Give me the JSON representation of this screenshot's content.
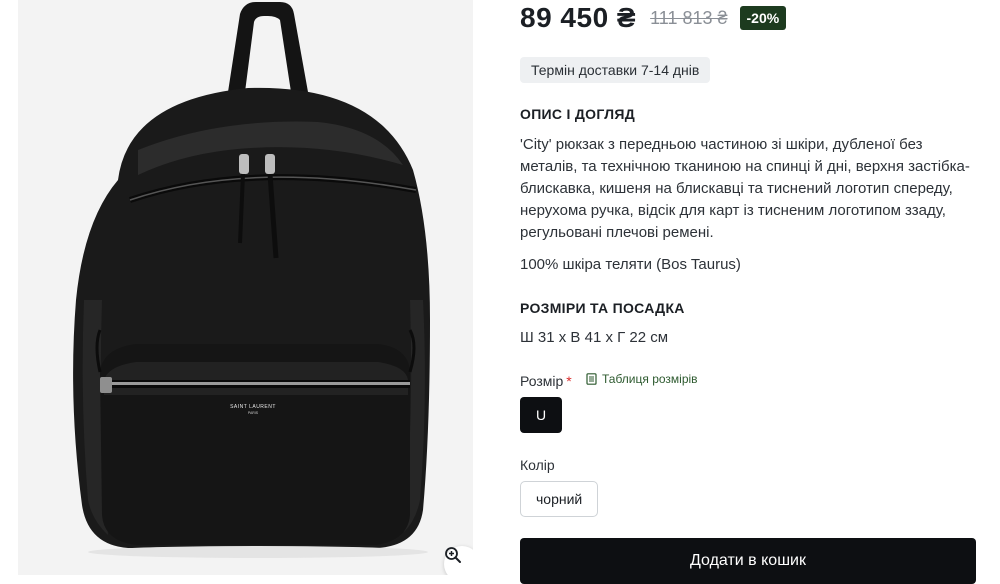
{
  "gallery": {
    "image_alt": "Saint Laurent City backpack",
    "brand_print": "SAINT LAURENT",
    "brand_print_sub": "PARIS",
    "zoom_icon": "zoom-in-icon"
  },
  "price": {
    "current": "89 450 ₴",
    "old": "111 813 ₴",
    "discount": "-20%"
  },
  "delivery": "Термін доставки 7-14 днів",
  "description": {
    "title": "ОПИС І ДОГЛЯД",
    "text": "'City' рюкзак з передньою частиною зі шкіри, дубленої без металів, та технічною тканиною на спинці й дні, верхня застібка-блискавка, кишеня на блискавці та тиснений логотип спереду, нерухома ручка, відсік для карт із тисненим логотипом ззаду, регульовані плечові ремені.",
    "material": "100% шкіра теляти (Bos Taurus)"
  },
  "sizing": {
    "title": "РОЗМІРИ ТА ПОСАДКА",
    "dimensions": "Ш 31 x В 41 x Г 22 см"
  },
  "size": {
    "label": "Розмір",
    "required_mark": "*",
    "table_link": "Таблиця розмірів",
    "table_icon": "size-table-icon",
    "selected": "U"
  },
  "color": {
    "label": "Колір",
    "selected": "чорний"
  },
  "cart": {
    "button_label": "Додати в кошик"
  },
  "colors": {
    "discount_bg": "#1d3b1f",
    "link_green": "#2d5a2f",
    "button_bg": "#0d0f12",
    "required": "#d92b2b"
  }
}
